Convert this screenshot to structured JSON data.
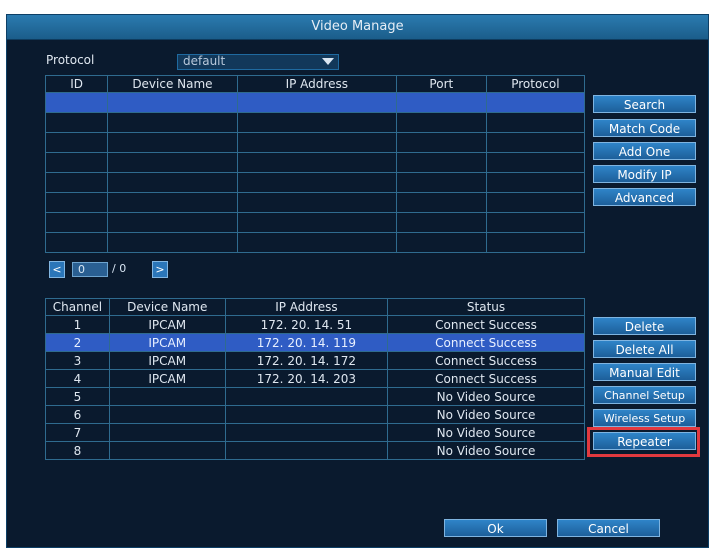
{
  "window": {
    "title": "Video Manage"
  },
  "protocol": {
    "label": "Protocol",
    "value": "default",
    "dropdown_icon": "caret-down-icon"
  },
  "device_table": {
    "headers": [
      "ID",
      "Device Name",
      "IP Address",
      "Port",
      "Protocol"
    ],
    "rows": [
      [
        "",
        "",
        "",
        "",
        ""
      ],
      [
        "",
        "",
        "",
        "",
        ""
      ],
      [
        "",
        "",
        "",
        "",
        ""
      ],
      [
        "",
        "",
        "",
        "",
        ""
      ],
      [
        "",
        "",
        "",
        "",
        ""
      ],
      [
        "",
        "",
        "",
        "",
        ""
      ],
      [
        "",
        "",
        "",
        "",
        ""
      ],
      [
        "",
        "",
        "",
        "",
        ""
      ]
    ],
    "selected_row": 0
  },
  "pager": {
    "prev_icon": "chevron-left-icon",
    "next_icon": "chevron-right-icon",
    "current": "0",
    "separator": "/",
    "total": "0"
  },
  "right_buttons_top": {
    "search": "Search",
    "match_code": "Match Code",
    "add_one": "Add One",
    "modify_ip": "Modify IP",
    "advanced": "Advanced"
  },
  "channel_table": {
    "headers": [
      "Channel",
      "Device Name",
      "IP Address",
      "Status"
    ],
    "rows": [
      [
        "1",
        "IPCAM",
        "172. 20. 14. 51",
        "Connect Success"
      ],
      [
        "2",
        "IPCAM",
        "172. 20. 14. 119",
        "Connect Success"
      ],
      [
        "3",
        "IPCAM",
        "172. 20. 14. 172",
        "Connect Success"
      ],
      [
        "4",
        "IPCAM",
        "172. 20. 14. 203",
        "Connect Success"
      ],
      [
        "5",
        "",
        "",
        "No Video Source"
      ],
      [
        "6",
        "",
        "",
        "No Video Source"
      ],
      [
        "7",
        "",
        "",
        "No Video Source"
      ],
      [
        "8",
        "",
        "",
        "No Video Source"
      ]
    ],
    "selected_row": 1
  },
  "right_buttons_bottom": {
    "delete": "Delete",
    "delete_all": "Delete All",
    "manual_edit": "Manual Edit",
    "channel_setup": "Channel Setup",
    "wireless_setup": "Wireless Setup",
    "repeater": "Repeater"
  },
  "footer": {
    "ok": "Ok",
    "cancel": "Cancel"
  },
  "colors": {
    "background": "#0a1a2e",
    "selection": "#2f5cc4",
    "button": "#2f84c8",
    "highlight": "#e2393f"
  }
}
